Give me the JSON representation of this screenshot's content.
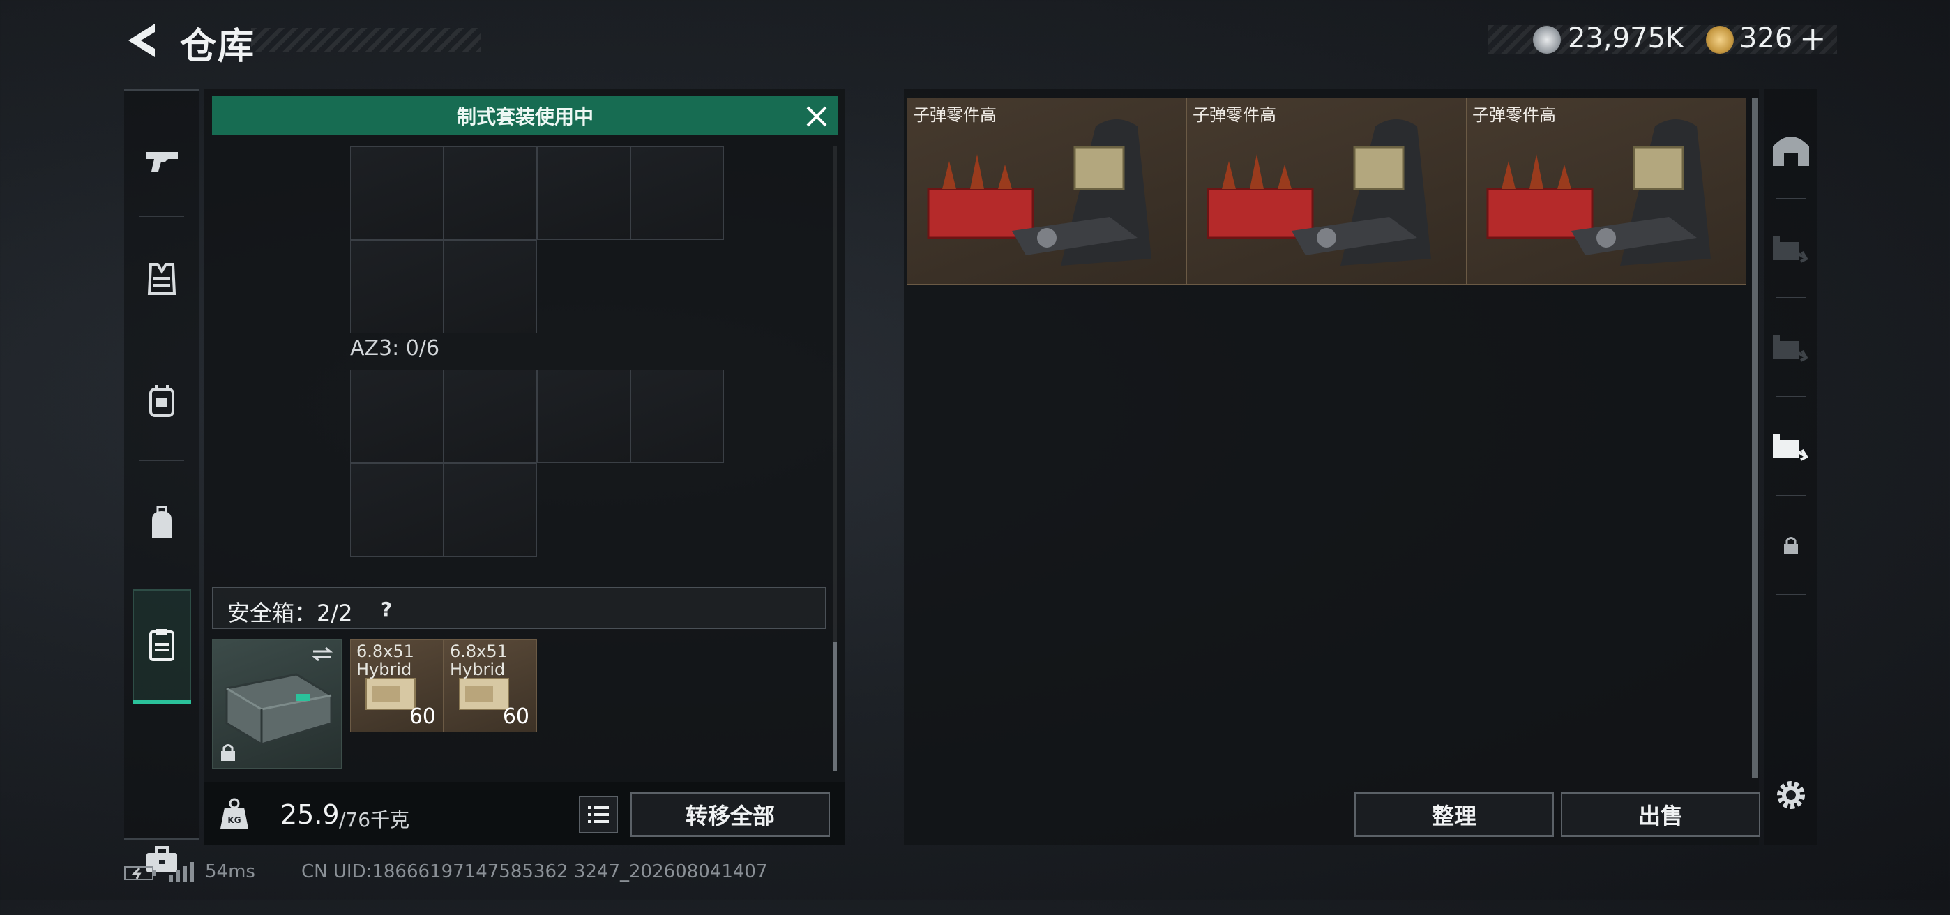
{
  "header": {
    "title": "仓库",
    "currency_silver": "23,975K",
    "currency_gold": "326",
    "add_label": "+"
  },
  "left_sidebar": {
    "items": [
      {
        "name": "weapons",
        "icon": "pistol-icon"
      },
      {
        "name": "armor",
        "icon": "vest-icon"
      },
      {
        "name": "chest-rig",
        "icon": "rig-icon"
      },
      {
        "name": "backpack",
        "icon": "backpack-icon"
      },
      {
        "name": "secure-case",
        "icon": "clipboard-icon",
        "active": true
      },
      {
        "name": "tools",
        "icon": "toolbox-icon"
      }
    ]
  },
  "loadout": {
    "banner": "制式套装使用中",
    "az3_label": "AZ3: 0/6",
    "safe_box_label": "安全箱：2/2",
    "help": "?",
    "ammo": [
      {
        "name_line1": "6.8x51",
        "name_line2": "Hybrid",
        "count": "60"
      },
      {
        "name_line1": "6.8x51",
        "name_line2": "Hybrid",
        "count": "60"
      }
    ],
    "weight_current": "25.9",
    "weight_max": "/76千克",
    "transfer_all": "转移全部"
  },
  "stash": {
    "items": [
      {
        "label": "子弹零件高"
      },
      {
        "label": "子弹零件高"
      },
      {
        "label": "子弹零件高"
      }
    ],
    "sort_button": "整理",
    "sell_button": "出售"
  },
  "right_sidebar": {
    "items": [
      {
        "icon": "bunker-icon"
      },
      {
        "icon": "storage-a-icon"
      },
      {
        "icon": "storage-b-icon"
      },
      {
        "icon": "storage-c-icon",
        "active": true
      },
      {
        "icon": "lock-icon"
      }
    ]
  },
  "status_bar": {
    "ping": "54ms",
    "uid": "CN UID:18666197147585362 3247_202608041407"
  },
  "colors": {
    "accent_green": "#176c52",
    "active_green": "#2bc29b",
    "ammo_brown": "#5a4a39"
  }
}
